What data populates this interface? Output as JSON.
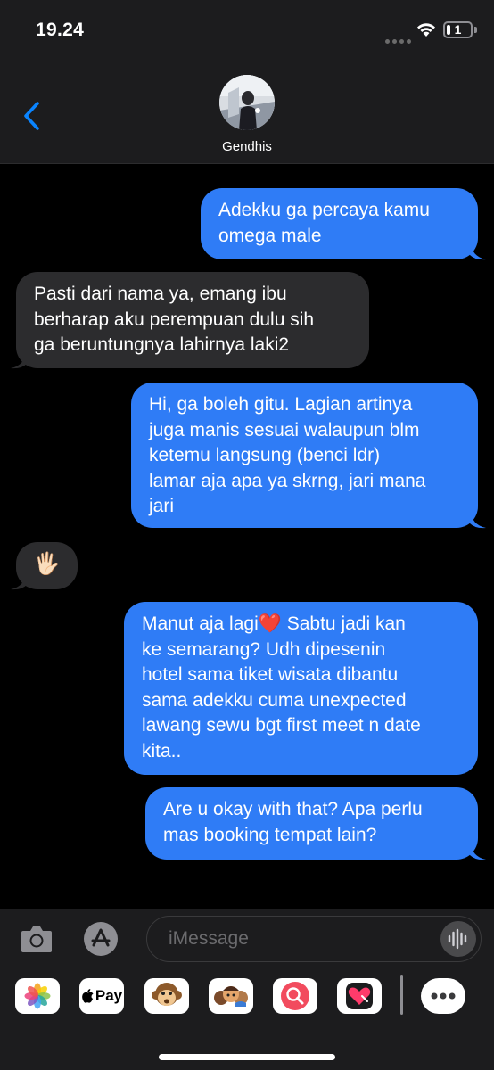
{
  "status_bar": {
    "time": "19.24",
    "battery": "1"
  },
  "header": {
    "contact_name": "Gendhis",
    "back_icon": "chevron-left-icon"
  },
  "messages": [
    {
      "direction": "sent",
      "text": "Adekku ga percaya kamu\nomega male"
    },
    {
      "direction": "received",
      "text": "Pasti dari nama ya, emang ibu\nberharap aku perempuan dulu sih\nga beruntungnya lahirnya laki2"
    },
    {
      "direction": "sent",
      "text": "Hi, ga boleh gitu. Lagian artinya\njuga manis sesuai walaupun blm\nketemu langsung (benci ldr)\nlamar aja apa ya skrng, jari mana\njari"
    },
    {
      "direction": "received",
      "text": "🖐🏻"
    },
    {
      "direction": "sent",
      "text": "Manut aja lagi❤️  Sabtu jadi kan\nke semarang? Udh dipesenin\nhotel sama tiket wisata dibantu\nsama adekku cuma unexpected\nlawang sewu bgt first meet n date\nkita.."
    },
    {
      "direction": "sent",
      "text": "Are u okay with that? Apa perlu\nmas booking tempat lain?"
    }
  ],
  "input_bar": {
    "placeholder": "iMessage"
  },
  "app_drawer": {
    "apple_pay_label": "Pay",
    "apps": [
      "photos-icon",
      "apple-pay-icon",
      "animoji-icon",
      "memoji-icon",
      "web-images-icon",
      "digital-touch-icon",
      "more-icon"
    ]
  },
  "colors": {
    "sent_bubble": "#2f7cf6",
    "received_bubble": "#2c2c2e",
    "accent": "#0a84ff"
  }
}
